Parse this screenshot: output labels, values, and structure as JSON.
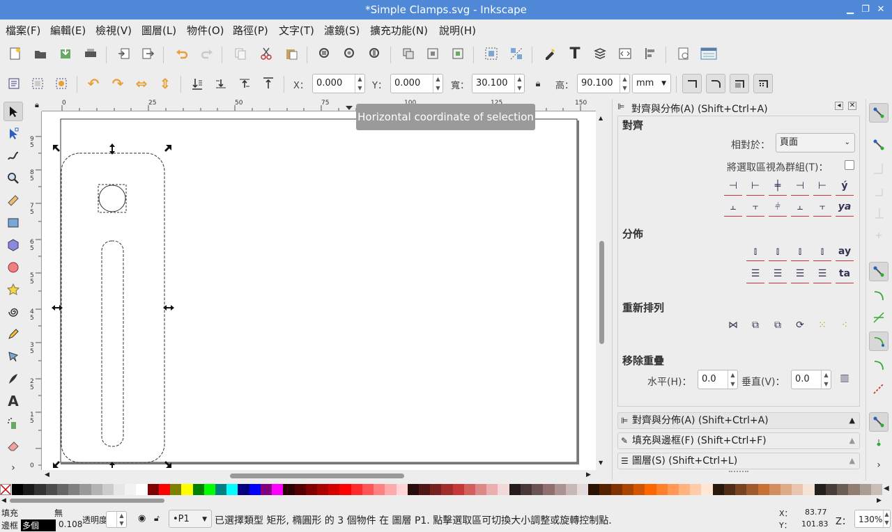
{
  "window": {
    "title": "*Simple Clamps.svg - Inkscape",
    "minimize": "▁",
    "maximize": "❐",
    "close": "✕"
  },
  "menu": [
    "檔案(F)",
    "編輯(E)",
    "檢視(V)",
    "圖層(L)",
    "物件(O)",
    "路徑(P)",
    "文字(T)",
    "濾鏡(S)",
    "擴充功能(N)",
    "說明(H)"
  ],
  "toolbar2": {
    "x_label": "X：",
    "x_value": "0.000",
    "y_label": "Y：",
    "y_value": "0.000",
    "w_label": "寬：",
    "w_value": "30.100",
    "h_label": "高：",
    "h_value": "90.100",
    "unit": "mm"
  },
  "tooltip": "Horizontal coordinate of selection",
  "rulers": {
    "h": [
      "0",
      "25",
      "50",
      "75",
      "100",
      "125",
      "150"
    ],
    "v": [
      "9 5",
      "8 5",
      "7 5",
      "6 5",
      "5 5",
      "4 5",
      "3 5",
      "2 5",
      "1 5",
      "0"
    ]
  },
  "dock": {
    "title": "對齊與分佈(A) (Shift+Ctrl+A)",
    "align_header": "對齊",
    "relative_label": "相對於：",
    "relative_value": "頁面",
    "group_label": "將選取區視為群組(T)：",
    "distribute_header": "分佈",
    "rearrange_header": "重新排列",
    "overlap_header": "移除重疊",
    "h_label": "水平(H)：",
    "h_value": "0.0",
    "v_label": "垂直(V)：",
    "v_value": "0.0",
    "panels": [
      "對齊與分佈(A) (Shift+Ctrl+A)",
      "填充與邊框(F) (Shift+Ctrl+F)",
      "圖層(S) (Shift+Ctrl+L)"
    ]
  },
  "palette": [
    "#000000",
    "#1a1a1a",
    "#333333",
    "#4d4d4d",
    "#666666",
    "#808080",
    "#999999",
    "#b3b3b3",
    "#cccccc",
    "#e6e6e6",
    "#f2f2f2",
    "#ffffff",
    "#800000",
    "#ff0000",
    "#808000",
    "#ffff00",
    "#008000",
    "#00ff00",
    "#008080",
    "#00ffff",
    "#000080",
    "#0000ff",
    "#800080",
    "#ff00ff",
    "#2b0000",
    "#550000",
    "#800000",
    "#aa0000",
    "#d40000",
    "#ff0000",
    "#ff2a2a",
    "#ff5555",
    "#ff8080",
    "#ffaaaa",
    "#ffd5d5",
    "#280b0b",
    "#501616",
    "#782121",
    "#a02c2c",
    "#c83737",
    "#d35f5f",
    "#de8787",
    "#e9afaf",
    "#f4d7d7",
    "#241c1c",
    "#483737",
    "#6c5353",
    "#916f6f",
    "#ac9393",
    "#c8b7b7",
    "#e3dbdb",
    "#2b1100",
    "#552200",
    "#803300",
    "#aa4400",
    "#d45500",
    "#ff6600",
    "#ff7f2a",
    "#ff9955",
    "#ffb380",
    "#ffccaa",
    "#ffe6d5",
    "#28170b",
    "#502d16",
    "#784421",
    "#a05a2c",
    "#c87137",
    "#d38d5f",
    "#deaa87",
    "#e9c6af",
    "#f4e3d7",
    "#241f1c",
    "#483e37",
    "#6c5d53",
    "#917c6f",
    "#ac9d93",
    "#c8beb7"
  ],
  "status": {
    "fill_label": "填充",
    "fill_value": "無",
    "stroke_label": "邊框",
    "stroke_value": "多個",
    "stroke_width": "0.108",
    "opacity_label": "透明度：",
    "layer": "•P1",
    "message": "已選擇類型 矩形, 橢圓形 的 3 個物件 在 圖層 P1. 點擊選取區可切換大小調整或旋轉控制點.",
    "coord_x_label": "X：",
    "coord_x": "83.77",
    "coord_y_label": "Y：",
    "coord_y": "101.83",
    "zoom_label": "Z：",
    "zoom": "130%"
  }
}
